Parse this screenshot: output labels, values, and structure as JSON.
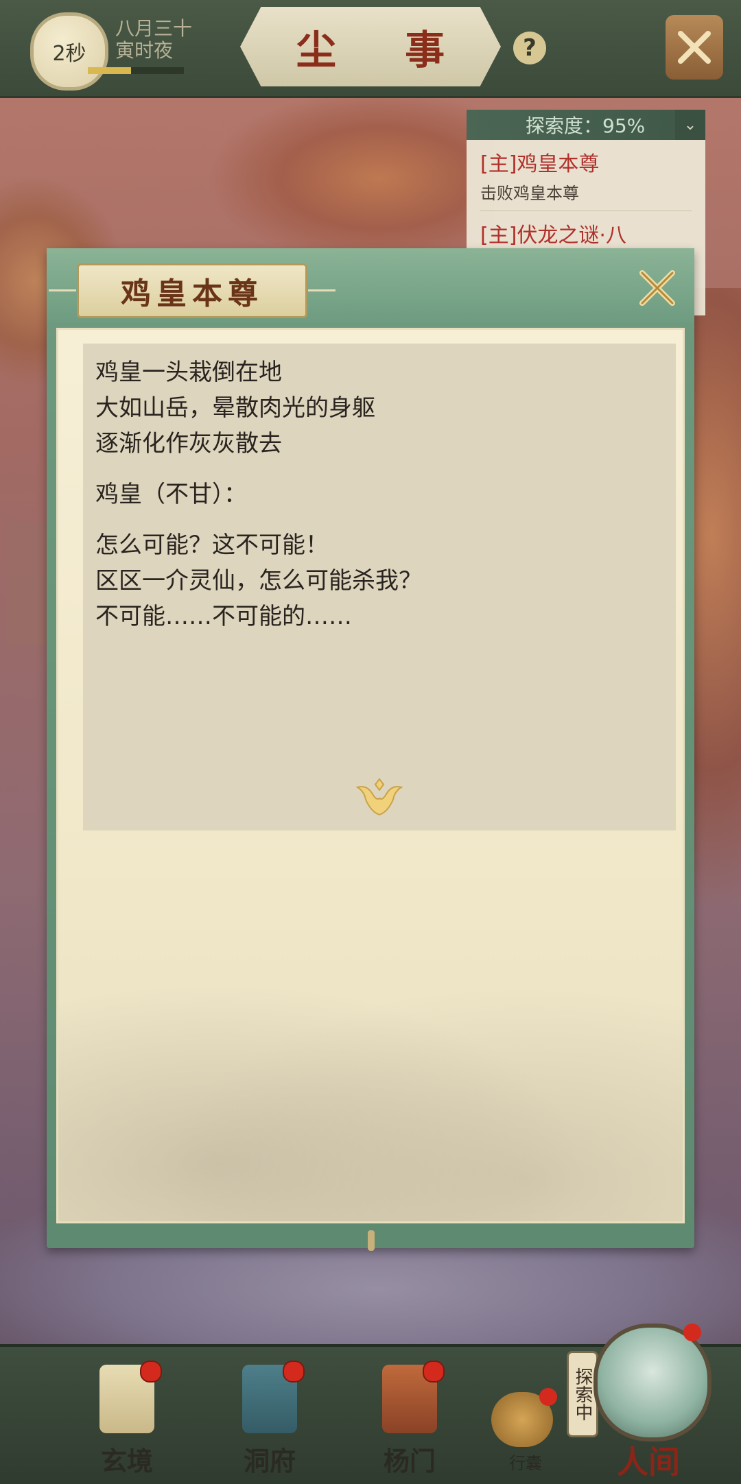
{
  "header": {
    "timer": "2秒",
    "date_line1": "八月三十",
    "date_line2": "寅时夜",
    "progress": 0.45,
    "title": "尘 事",
    "help": "?"
  },
  "quest_panel": {
    "exploration": "探索度：95%",
    "quests": [
      {
        "title": "[主]鸡皇本尊",
        "desc": "击败鸡皇本尊"
      },
      {
        "title": "[主]伏龙之谜·八",
        "desc": ""
      }
    ]
  },
  "dialog": {
    "speaker": "鸡皇本尊",
    "paragraphs": [
      [
        "鸡皇一头栽倒在地",
        "大如山岳，晕散肉光的身躯",
        "逐渐化作灰灰散去"
      ],
      [
        "鸡皇（不甘）："
      ],
      [
        "怎么可能？这不可能！",
        "区区一介灵仙，怎么可能杀我？",
        "不可能……不可能的……"
      ]
    ]
  },
  "bottom_nav": {
    "items": [
      {
        "label": "玄境",
        "icon": "scroll-icon"
      },
      {
        "label": "洞府",
        "icon": "pavilion-icon"
      },
      {
        "label": "杨门",
        "icon": "banner-icon"
      }
    ],
    "bag_label": "行囊",
    "human_label": "人间",
    "explore_tag": "探索中"
  },
  "colors": {
    "accent_green": "#6f9a80",
    "title_red": "#8a2d1a",
    "quest_red": "#b0302a",
    "badge_red": "#d42a1e"
  }
}
